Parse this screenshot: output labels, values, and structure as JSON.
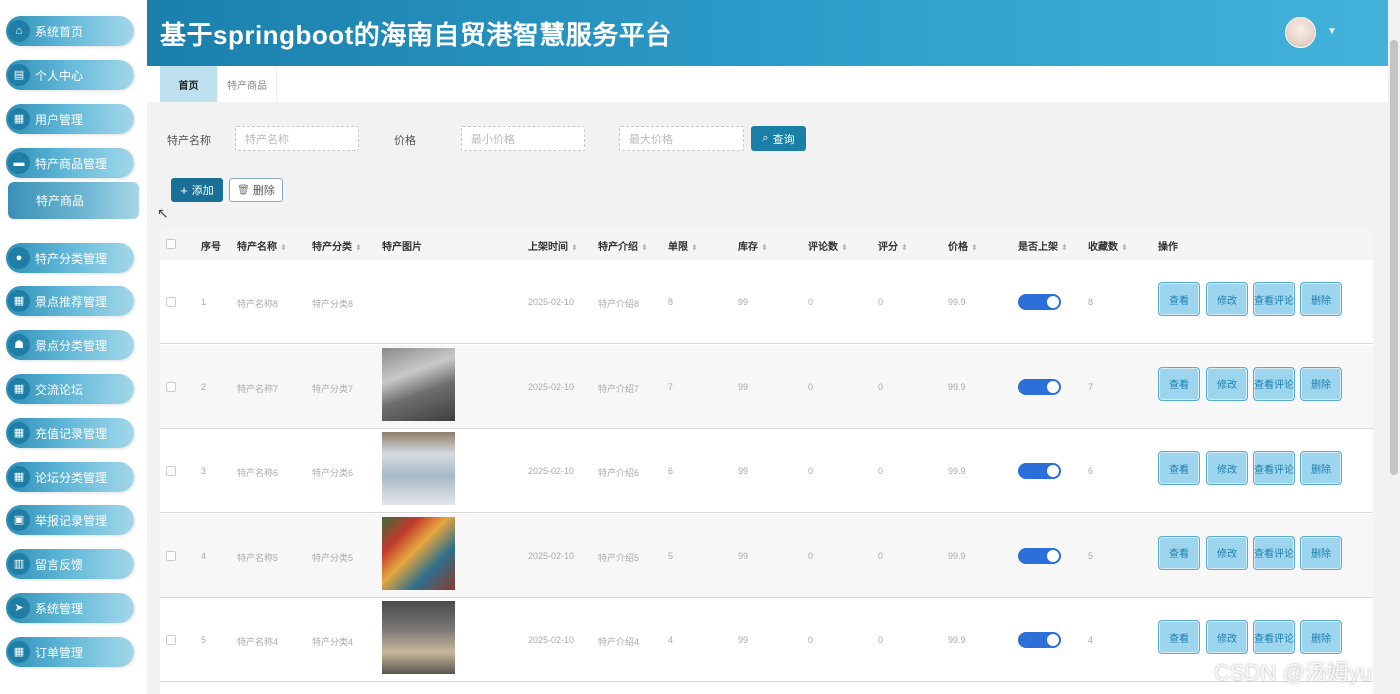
{
  "header": {
    "title": "基于springboot的海南自贸港智慧服务平台"
  },
  "sidebar": {
    "items": [
      {
        "label": "系统首页",
        "icon": "home-icon"
      },
      {
        "label": "个人中心",
        "icon": "user-card-icon"
      },
      {
        "label": "用户管理",
        "icon": "grid-icon"
      },
      {
        "label": "特产商品管理",
        "icon": "monitor-icon"
      },
      {
        "label": "特产分类管理",
        "icon": "bulb-icon"
      },
      {
        "label": "景点推荐管理",
        "icon": "grid-icon"
      },
      {
        "label": "景点分类管理",
        "icon": "person-icon"
      },
      {
        "label": "交流论坛",
        "icon": "grid-icon"
      },
      {
        "label": "充值记录管理",
        "icon": "grid-icon"
      },
      {
        "label": "论坛分类管理",
        "icon": "grid-icon"
      },
      {
        "label": "举报记录管理",
        "icon": "briefcase-icon"
      },
      {
        "label": "留言反馈",
        "icon": "clipboard-icon"
      },
      {
        "label": "系统管理",
        "icon": "send-icon"
      },
      {
        "label": "订单管理",
        "icon": "grid-icon"
      }
    ],
    "sub_item": "特产商品"
  },
  "tabs": [
    {
      "label": "首页"
    },
    {
      "label": "特产商品"
    }
  ],
  "search": {
    "name_label": "特产名称",
    "name_placeholder": "特产名称",
    "price_label": "价格",
    "min_placeholder": "最小价格",
    "max_placeholder": "最大价格",
    "search_button": "查询"
  },
  "actions": {
    "add": "添加",
    "delete": "删除"
  },
  "table": {
    "columns": [
      "序号",
      "特产名称",
      "特产分类",
      "特产图片",
      "上架时间",
      "特产介绍",
      "单限",
      "库存",
      "评论数",
      "评分",
      "价格",
      "是否上架",
      "收藏数",
      "操作"
    ],
    "rows": [
      {
        "index": "1",
        "name": "特产名称8",
        "category": "特产分类8",
        "date": "2025-02-10",
        "intro": "特产介绍8",
        "limit": "8",
        "stock": "99",
        "comments": "0",
        "score": "0",
        "price": "99.9",
        "on_shelf": true,
        "favorites": "8",
        "has_image": false
      },
      {
        "index": "2",
        "name": "特产名称7",
        "category": "特产分类7",
        "date": "2025-02-10",
        "intro": "特产介绍7",
        "limit": "7",
        "stock": "99",
        "comments": "0",
        "score": "0",
        "price": "99.9",
        "on_shelf": true,
        "favorites": "7",
        "has_image": true
      },
      {
        "index": "3",
        "name": "特产名称6",
        "category": "特产分类6",
        "date": "2025-02-10",
        "intro": "特产介绍6",
        "limit": "6",
        "stock": "99",
        "comments": "0",
        "score": "0",
        "price": "99.9",
        "on_shelf": true,
        "favorites": "6",
        "has_image": true
      },
      {
        "index": "4",
        "name": "特产名称5",
        "category": "特产分类5",
        "date": "2025-02-10",
        "intro": "特产介绍5",
        "limit": "5",
        "stock": "99",
        "comments": "0",
        "score": "0",
        "price": "99.9",
        "on_shelf": true,
        "favorites": "5",
        "has_image": true
      },
      {
        "index": "5",
        "name": "特产名称4",
        "category": "特产分类4",
        "date": "2025-02-10",
        "intro": "特产介绍4",
        "limit": "4",
        "stock": "99",
        "comments": "0",
        "score": "0",
        "price": "99.9",
        "on_shelf": true,
        "favorites": "4",
        "has_image": true
      }
    ],
    "row_buttons": [
      "查看",
      "修改",
      "查看评论",
      "删除"
    ]
  },
  "watermark": "CSDN @汤姆yu",
  "colors": {
    "header": "#1b7fab",
    "accent": "#1a7fa7",
    "toggle_on": "#2d6fd9",
    "action_button": "#9ed5ee"
  }
}
